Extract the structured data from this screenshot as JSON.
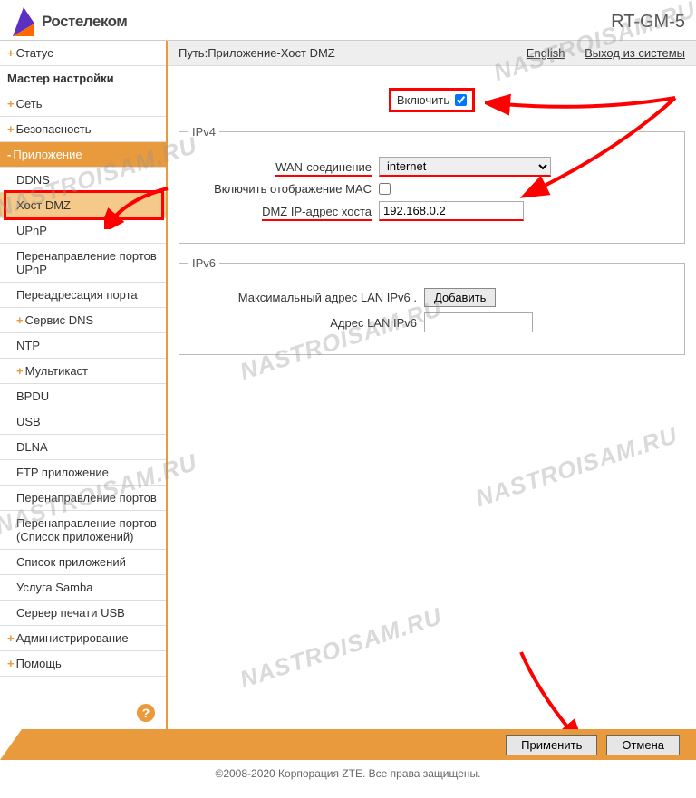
{
  "header": {
    "logo_text": "Ростелеком",
    "model": "RT-GM-5"
  },
  "topbar": {
    "path_label": "Путь:",
    "path_value": "Приложение-Хост DMZ",
    "english": "English",
    "logout": "Выход из системы"
  },
  "sidebar": {
    "items": [
      {
        "label": "Статус",
        "type": "top",
        "plus": true
      },
      {
        "label": "Мастер настройки",
        "type": "bold"
      },
      {
        "label": "Сеть",
        "type": "top",
        "plus": true
      },
      {
        "label": "Безопасность",
        "type": "top",
        "plus": true
      },
      {
        "label": "Приложение",
        "type": "active"
      },
      {
        "label": "DDNS",
        "type": "sub"
      },
      {
        "label": "Хост DMZ",
        "type": "sub-active"
      },
      {
        "label": "UPnP",
        "type": "sub"
      },
      {
        "label": "Перенаправление портов UPnP",
        "type": "sub"
      },
      {
        "label": "Переадресация порта",
        "type": "sub"
      },
      {
        "label": "Сервис DNS",
        "type": "sub",
        "plus": true
      },
      {
        "label": "NTP",
        "type": "sub"
      },
      {
        "label": "Мультикаст",
        "type": "sub",
        "plus": true
      },
      {
        "label": "BPDU",
        "type": "sub"
      },
      {
        "label": "USB",
        "type": "sub"
      },
      {
        "label": "DLNA",
        "type": "sub"
      },
      {
        "label": "FTP приложение",
        "type": "sub"
      },
      {
        "label": "Перенаправление портов",
        "type": "sub"
      },
      {
        "label": "Перенаправление портов (Список приложений)",
        "type": "sub"
      },
      {
        "label": "Список приложений",
        "type": "sub"
      },
      {
        "label": "Услуга Samba",
        "type": "sub"
      },
      {
        "label": "Сервер печати USB",
        "type": "sub"
      },
      {
        "label": "Администрирование",
        "type": "top",
        "plus": true
      },
      {
        "label": "Помощь",
        "type": "top",
        "plus": true
      }
    ]
  },
  "form": {
    "enable_label": "Включить",
    "enable_checked": true,
    "ipv4_legend": "IPv4",
    "wan_label": "WAN-соединение",
    "wan_value": "internet",
    "mac_label": "Включить отображение MAC",
    "mac_checked": false,
    "dmz_label": "DMZ IP-адрес хоста",
    "dmz_value": "192.168.0.2",
    "ipv6_legend": "IPv6",
    "ipv6_max_label": "Максимальный адрес LAN IPv6 .",
    "add_btn": "Добавить",
    "ipv6_addr_label": "Адрес LAN IPv6",
    "ipv6_addr_value": ""
  },
  "footer": {
    "apply": "Применить",
    "cancel": "Отмена",
    "copyright": "©2008-2020 Корпорация ZTE. Все права защищены."
  },
  "watermark": "NASTROISAM.RU"
}
